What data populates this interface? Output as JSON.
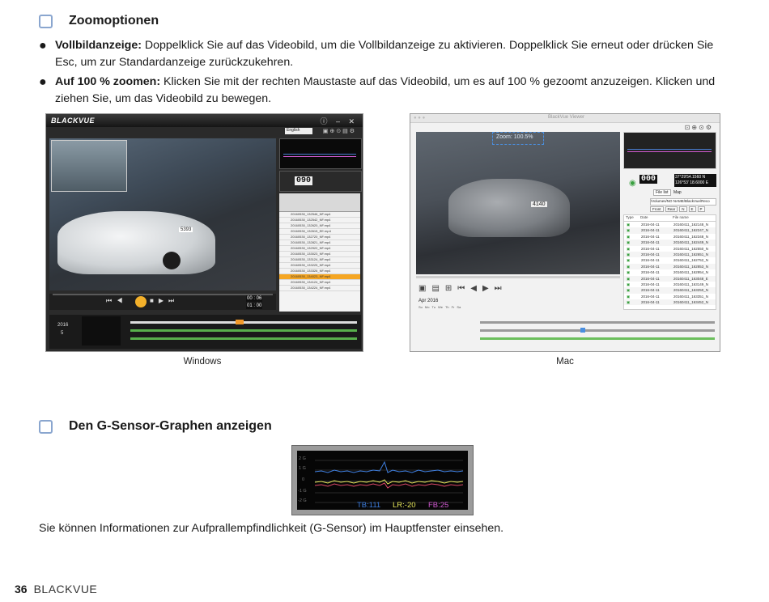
{
  "section1": {
    "title": "Zoomoptionen",
    "bullets": [
      {
        "term": "Vollbildanzeige:",
        "text": " Doppelklick Sie auf das Videobild, um die Vollbildanzeige zu aktivieren. Doppelklick Sie erneut oder drücken Sie Esc, um zur Standardanzeige zurückzukehren."
      },
      {
        "term": "Auf 100 % zoomen:",
        "text": " Klicken Sie mit der rechten Maustaste auf das Videobild, um es auf 100 % gezoomt anzuzeigen. Klicken und ziehen Sie, um das Videobild zu bewegen."
      }
    ]
  },
  "windows_shot": {
    "caption": "Windows",
    "logo": "BLACKVUE",
    "language": "English",
    "speed": "090",
    "time_a": "00 : 06",
    "time_b": "01 : 00",
    "plate": "5393",
    "year": "2016",
    "month": "5",
    "files": [
      "20160530_132546_NF.mp4",
      "20160530_132542_NF.mp4",
      "20160530_132620_NF.mp4",
      "20160530_132615_EE.mp4",
      "20160530_132720_NF.mp4",
      "20160530_132821_NF.mp4",
      "20160530_132922_NF.mp4",
      "20160530_133023_NF.mp4",
      "20160530_133124_NF.mp4",
      "20160530_133225_NF.mp4",
      "20160530_133326_NF.mp4",
      "20160530_134023_NF.mp4",
      "20160530_134124_NF.mp4",
      "20160530_134224_NF.mp4"
    ]
  },
  "mac_shot": {
    "caption": "Mac",
    "window_title": "BlackVue Viewer",
    "zoom_label": "Zoom: 100.5%",
    "plate": "4140",
    "speed": "000",
    "coords": [
      "37°29'54.1560 N",
      "126°53' 18.6000 E"
    ],
    "tabs": [
      "File list",
      "Map"
    ],
    "path": "/Volumes/NO NAME/BlackVue/Reco",
    "filters": [
      "Front",
      "Rear",
      "N",
      "E",
      "P"
    ],
    "table_headers": [
      "Type",
      "Date",
      "File name"
    ],
    "dates": [
      "2016-04-11",
      "2016-04-11",
      "2016-04-11",
      "2016-04-11",
      "2016-04-11",
      "2016-04-11",
      "2016-04-11",
      "2016-04-11",
      "2016-04-11",
      "2016-04-11",
      "2016-04-11",
      "2016-04-11",
      "2016-04-11",
      "2016-04-11"
    ],
    "names": [
      "20160411_162148_N",
      "20160411_162247_N",
      "20160411_162348_N",
      "20160411_162449_N",
      "20160411_162550_N",
      "20160411_162651_N",
      "20160411_162752_N",
      "20160411_162853_N",
      "20160411_162954_N",
      "20160411_163048_E",
      "20160411_163149_N",
      "20160411_163250_N",
      "20160411_163351_N",
      "20160411_163452_N"
    ],
    "month_label": "Apr 2016",
    "weekdays": [
      "Su",
      "Mo",
      "Tu",
      "We",
      "Th",
      "Fr",
      "Sa"
    ]
  },
  "section2": {
    "title": "Den G-Sensor-Graphen anzeigen",
    "graph": {
      "tb": "TB:111",
      "lr": "LR:-20",
      "fb": "FB:25",
      "ticks": [
        "2 G",
        "1 G",
        "0",
        "-1 G",
        "-2 G"
      ]
    },
    "paragraph": "Sie können Informationen zur Aufprallempfindlichkeit (G-Sensor) im Hauptfenster einsehen."
  },
  "footer": {
    "page": "36",
    "brand": "BLACKVUE"
  }
}
